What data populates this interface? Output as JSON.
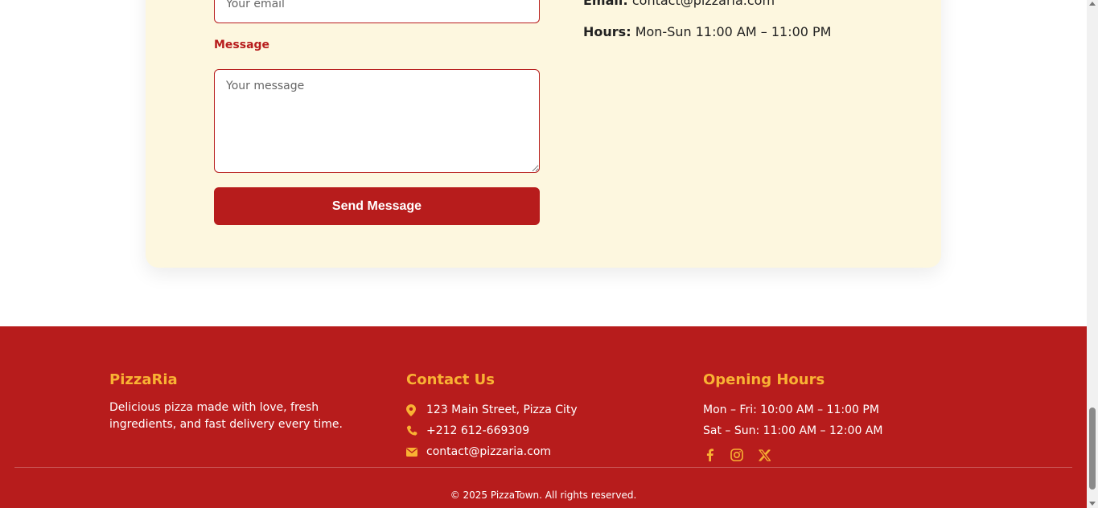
{
  "form": {
    "email_placeholder": "Your email",
    "message_label": "Message",
    "message_placeholder": "Your message",
    "send_label": "Send Message"
  },
  "info": {
    "email_label": "Email:",
    "email_value": "contact@pizzaria.com",
    "hours_label": "Hours:",
    "hours_value": "Mon-Sun 11:00 AM – 11:00 PM"
  },
  "footer": {
    "brand": "PizzaRia",
    "about": "Delicious pizza made with love, fresh ingredients, and fast delivery every time.",
    "contact_title": "Contact Us",
    "address": "123 Main Street, Pizza City",
    "phone": "+212 612-669309",
    "email": "contact@pizzaria.com",
    "hours_title": "Opening Hours",
    "weekday_hours": "Mon – Fri: 10:00 AM – 11:00 PM",
    "weekend_hours": "Sat – Sun: 11:00 AM – 12:00 AM",
    "social": [
      "facebook-icon",
      "instagram-icon",
      "x-icon"
    ],
    "copyright": "© 2025 PizzaTown. All rights reserved."
  },
  "colors": {
    "brand_red": "#b71c1c",
    "accent_yellow": "#f9b233",
    "card_bg": "#fdf7df"
  }
}
